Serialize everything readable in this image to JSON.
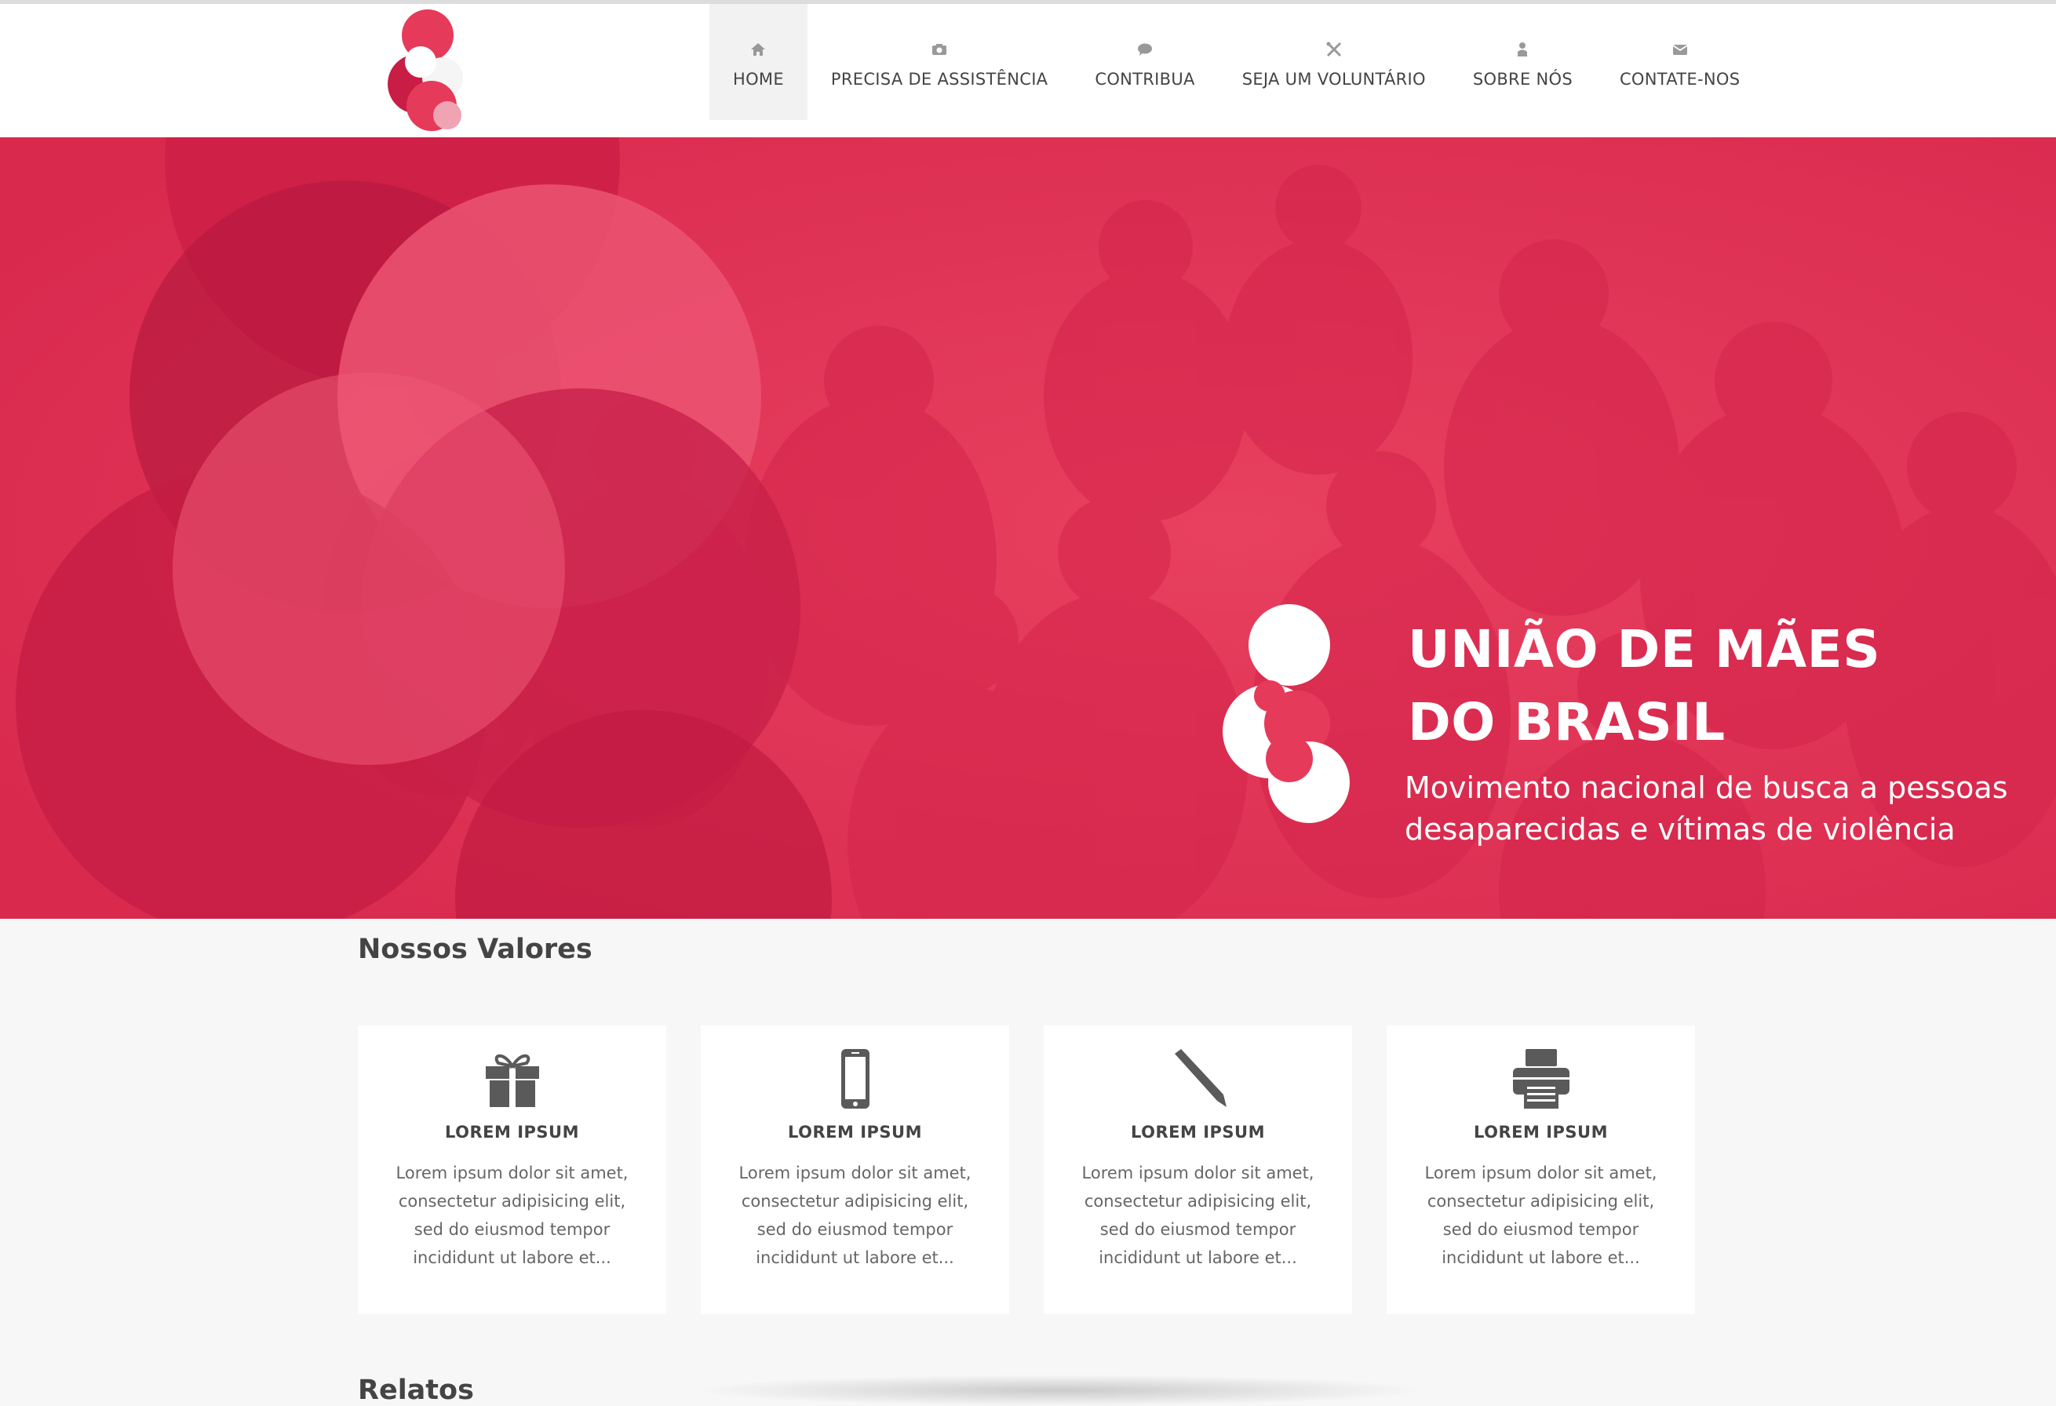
{
  "nav": {
    "items": [
      {
        "label": "HOME",
        "icon": "home-icon",
        "active": true
      },
      {
        "label": "PRECISA DE ASSISTÊNCIA",
        "icon": "camera-icon"
      },
      {
        "label": "CONTRIBUA",
        "icon": "chat-bubble-icon"
      },
      {
        "label": "SEJA UM VOLUNTÁRIO",
        "icon": "tools-icon"
      },
      {
        "label": "SOBRE NÓS",
        "icon": "user-icon"
      },
      {
        "label": "CONTATE-NOS",
        "icon": "envelope-icon"
      }
    ]
  },
  "hero": {
    "title_line1": "UNIÃO DE MÃES",
    "title_line2": "DO BRASIL",
    "subtitle_line1": "Movimento nacional de busca a pessoas",
    "subtitle_line2": "desaparecidas e vítimas de violência"
  },
  "values": {
    "title": "Nossos Valores",
    "cards": [
      {
        "icon": "gift-icon",
        "title": "LOREM IPSUM",
        "text": "Lorem ipsum dolor sit amet, consectetur adipisicing elit, sed do eiusmod tempor incididunt ut labore et..."
      },
      {
        "icon": "mobile-phone-icon",
        "title": "LOREM IPSUM",
        "text": "Lorem ipsum dolor sit amet, consectetur adipisicing elit, sed do eiusmod tempor incididunt ut labore et..."
      },
      {
        "icon": "pencil-icon",
        "title": "LOREM IPSUM",
        "text": "Lorem ipsum dolor sit amet, consectetur adipisicing elit, sed do eiusmod tempor incididunt ut labore et..."
      },
      {
        "icon": "printer-icon",
        "title": "LOREM IPSUM",
        "text": "Lorem ipsum dolor sit amet, consectetur adipisicing elit, sed do eiusmod tempor incididunt ut labore et..."
      }
    ]
  },
  "relatos": {
    "title": "Relatos"
  },
  "colors": {
    "brand": "#e63a5a",
    "brand_dark": "#c81d45",
    "text": "#444444",
    "muted": "#666666"
  }
}
